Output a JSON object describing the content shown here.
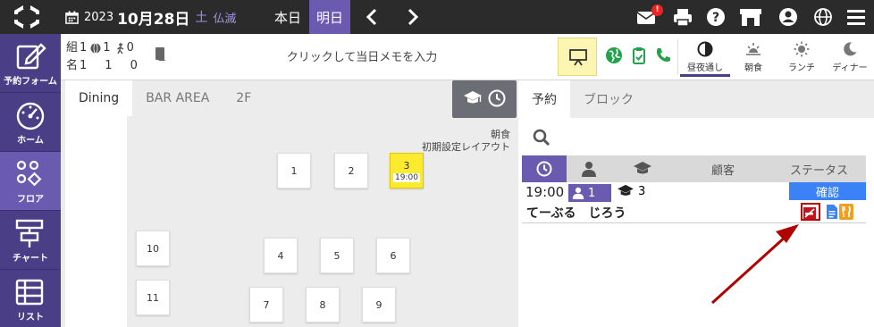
{
  "topbar": {
    "year": "2023",
    "month_day": "10月28日",
    "weekday": "土",
    "rokuyo": "仏滅",
    "today_label": "本日",
    "tomorrow_label": "明日",
    "mail_badge": "!",
    "icons": [
      "mail-icon",
      "print-icon",
      "help-icon",
      "shop-icon",
      "user-icon",
      "globe-icon",
      "menu-icon"
    ]
  },
  "sidebar": {
    "items": [
      {
        "label": "予約フォーム",
        "icon": "edit-icon"
      },
      {
        "label": "ホーム",
        "icon": "gauge-icon"
      },
      {
        "label": "フロア",
        "icon": "floor-icon",
        "active": true
      },
      {
        "label": "チャート",
        "icon": "chart-icon"
      },
      {
        "label": "リスト",
        "icon": "list-icon"
      }
    ]
  },
  "strip": {
    "row1": {
      "kumi_label": "組",
      "kumi": "1",
      "web": "1",
      "walkin": "0"
    },
    "row2": {
      "mei_label": "名",
      "mei": "1",
      "web": "1",
      "walkin": "0"
    },
    "memo_placeholder": "クリックして当日メモを入力",
    "modes": [
      {
        "label": "昼夜通し",
        "icon": "half-circle-icon",
        "active": true
      },
      {
        "label": "朝食",
        "icon": "sunrise-icon"
      },
      {
        "label": "ランチ",
        "icon": "sun-icon"
      },
      {
        "label": "ディナー",
        "icon": "moon-icon"
      }
    ]
  },
  "floor": {
    "tabs": [
      "Dining",
      "BAR AREA",
      "2F"
    ],
    "active_tab": "Dining",
    "layout_name_line1": "朝食",
    "layout_name_line2": "初期設定レイアウト",
    "tables": [
      {
        "label": "1"
      },
      {
        "label": "2"
      },
      {
        "label": "3",
        "time": "19:00",
        "booked": true
      },
      {
        "label": "10"
      },
      {
        "label": "4"
      },
      {
        "label": "5"
      },
      {
        "label": "6"
      },
      {
        "label": "11"
      },
      {
        "label": "7"
      },
      {
        "label": "8"
      },
      {
        "label": "9"
      }
    ]
  },
  "panel": {
    "tabs": [
      "予約",
      "ブロック"
    ],
    "active_tab": "予約",
    "search_placeholder": "",
    "headers": {
      "customer": "顧客",
      "status": "ステータス"
    },
    "reservation": {
      "time": "19:00",
      "guests": "1",
      "table": "3",
      "name": "てーぶる　じろう",
      "status": "確認",
      "status_color": "#3b82f6"
    }
  },
  "colors": {
    "accent": "#6a5ab0",
    "sidebar": "#4a3f87",
    "booked": "#fbea2e",
    "arrow": "#b00000"
  }
}
